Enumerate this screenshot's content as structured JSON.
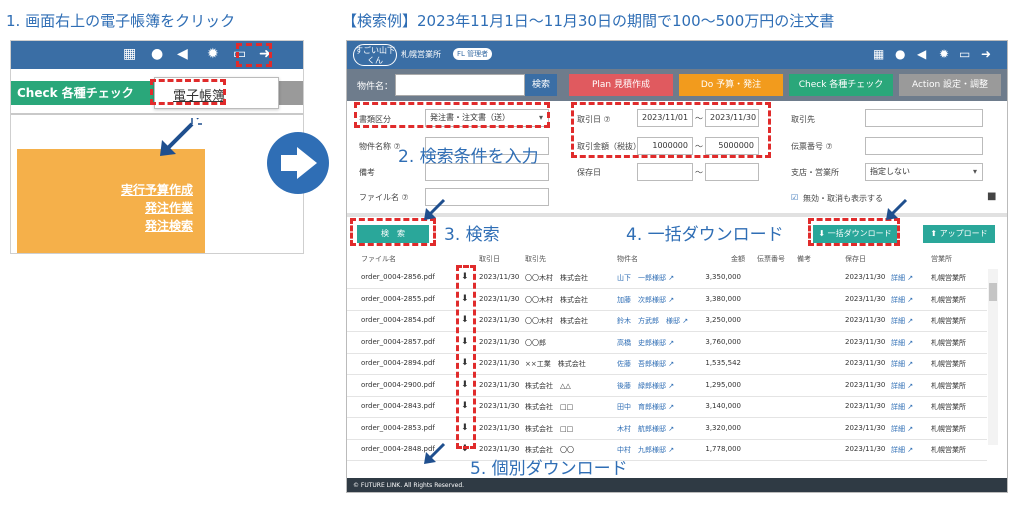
{
  "captions": {
    "step1": "1. 画面右上の電子帳簿をクリック",
    "example": "【検索例】2023年11月1日〜11月30日の期間で100〜500万円の注文書",
    "step2": "2. 検索条件を入力",
    "step3": "3. 検索",
    "step4": "4. 一括ダウンロード",
    "step5": "5. 個別ダウンロード"
  },
  "left_panel": {
    "check_label": "Check 各種チェック",
    "popup_item": "電子帳簿",
    "links": [
      "実行予算作成",
      "発注作業",
      "発注検索"
    ]
  },
  "app": {
    "logo_text": "すごい山下くん",
    "office": "札幌営業所",
    "role_badge": "FL 管理者",
    "search_label": "物件名：",
    "search_button": "検索",
    "tabs": [
      {
        "label": "Plan 見積作成",
        "color": "#e05a5f"
      },
      {
        "label": "Do 予算・発注",
        "color": "#f29b1d"
      },
      {
        "label": "Check 各種チェック",
        "color": "#2aa77a"
      },
      {
        "label": "Action 設定・調整",
        "color": "#9a9a9a"
      }
    ],
    "form": {
      "doc_type_label": "書類区分",
      "doc_type_value": "発注書・注文書（送）",
      "property_label": "物件名称 ⑦",
      "remarks_label": "備考",
      "file_name_label": "ファイル名 ⑦",
      "trade_date_label": "取引日 ⑦",
      "trade_date_from": "2023/11/01",
      "trade_date_to": "2023/11/30",
      "amount_label": "取引金額（税抜）",
      "amount_from": "1000000",
      "amount_to": "5000000",
      "saved_date_label": "保存日",
      "range_sep": "〜",
      "partner_label": "取引先",
      "slip_label": "伝票番号 ⑦",
      "branch_label": "支店・営業所",
      "branch_value": "指定しない",
      "show_invalid_label": "無効・取消も表示する"
    },
    "search_btn": "検　索",
    "bulk_download_btn": "⬇ 一括ダウンロード",
    "upload_btn": "⬆ アップロード",
    "columns": [
      "ファイル名",
      "取引日",
      "取引先",
      "物件名",
      "金額",
      "伝票番号",
      "備考",
      "保存日",
      "営業所"
    ],
    "rows": [
      {
        "file": "order_0004-2856.pdf",
        "date": "2023/11/30",
        "partner": "〇〇木村　株式会社",
        "property": "山下　一郎様邸 ↗",
        "amount": "3,350,000",
        "saved": "2023/11/30",
        "detail": "詳細 ↗",
        "branch": "札幌営業所"
      },
      {
        "file": "order_0004-2855.pdf",
        "date": "2023/11/30",
        "partner": "〇〇木村　株式会社",
        "property": "加藤　次郎様邸 ↗",
        "amount": "3,380,000",
        "saved": "2023/11/30",
        "detail": "詳細 ↗",
        "branch": "札幌営業所"
      },
      {
        "file": "order_0004-2854.pdf",
        "date": "2023/11/30",
        "partner": "〇〇木村　株式会社",
        "property": "鈴木　方武郎　様邸 ↗",
        "amount": "3,250,000",
        "saved": "2023/11/30",
        "detail": "詳細 ↗",
        "branch": "札幌営業所"
      },
      {
        "file": "order_0004-2857.pdf",
        "date": "2023/11/30",
        "partner": "〇〇郎",
        "property": "高橋　史郎様邸 ↗",
        "amount": "3,760,000",
        "saved": "2023/11/30",
        "detail": "詳細 ↗",
        "branch": "札幌営業所"
      },
      {
        "file": "order_0004-2894.pdf",
        "date": "2023/11/30",
        "partner": "××工業　株式会社",
        "property": "佐藤　吾郎様邸 ↗",
        "amount": "1,535,542",
        "saved": "2023/11/30",
        "detail": "詳細 ↗",
        "branch": "札幌営業所"
      },
      {
        "file": "order_0004-2900.pdf",
        "date": "2023/11/30",
        "partner": "株式会社　△△",
        "property": "後藤　緑郎様邸 ↗",
        "amount": "1,295,000",
        "saved": "2023/11/30",
        "detail": "詳細 ↗",
        "branch": "札幌営業所"
      },
      {
        "file": "order_0004-2843.pdf",
        "date": "2023/11/30",
        "partner": "株式会社　□□",
        "property": "田中　育郎様邸 ↗",
        "amount": "3,140,000",
        "saved": "2023/11/30",
        "detail": "詳細 ↗",
        "branch": "札幌営業所"
      },
      {
        "file": "order_0004-2853.pdf",
        "date": "2023/11/30",
        "partner": "株式会社　□□",
        "property": "木村　航郎様邸 ↗",
        "amount": "3,320,000",
        "saved": "2023/11/30",
        "detail": "詳細 ↗",
        "branch": "札幌営業所"
      },
      {
        "file": "order_0004-2848.pdf",
        "date": "2023/11/30",
        "partner": "株式会社　〇〇",
        "property": "中村　九郎様邸 ↗",
        "amount": "1,778,000",
        "saved": "2023/11/30",
        "detail": "詳細 ↗",
        "branch": "札幌営業所"
      }
    ],
    "footer": "© FUTURE LINK. All Rights Reserved."
  },
  "colors": {
    "header_blue": "#3a6ea5",
    "highlight_red": "#e02b2b",
    "caption_blue": "#2f6eb5",
    "action_teal": "#2aa79a"
  }
}
